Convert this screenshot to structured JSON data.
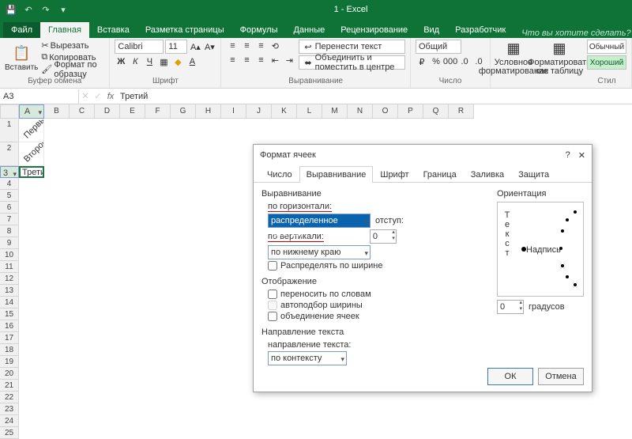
{
  "titlebar": {
    "title": "1 - Excel"
  },
  "menu": {
    "file": "Файл",
    "home": "Главная",
    "insert": "Вставка",
    "layout": "Разметка страницы",
    "formulas": "Формулы",
    "data": "Данные",
    "review": "Рецензирование",
    "view": "Вид",
    "developer": "Разработчик",
    "tell": "Что вы хотите сделать?"
  },
  "ribbon": {
    "clipboard": {
      "paste": "Вставить",
      "cut": "Вырезать",
      "copy": "Копировать",
      "painter": "Формат по образцу",
      "label": "Буфер обмена"
    },
    "font": {
      "name": "Calibri",
      "size": "11",
      "label": "Шрифт"
    },
    "align": {
      "wrap": "Перенести текст",
      "merge": "Объединить и поместить в центре",
      "label": "Выравнивание"
    },
    "number": {
      "fmt": "Общий",
      "label": "Число"
    },
    "cond": {
      "l1": "Условное",
      "l2": "форматирование"
    },
    "tbl": {
      "l1": "Форматировать",
      "l2": "как таблицу"
    },
    "styles": {
      "normal": "Обычный",
      "good": "Хороший",
      "label": "Стил"
    }
  },
  "formula": {
    "ref": "A3",
    "value": "Третий",
    "a1": "Первый",
    "a2": "Второй",
    "a3": "Третий"
  },
  "cols": [
    "A",
    "B",
    "C",
    "D",
    "E",
    "F",
    "G",
    "H",
    "I",
    "J",
    "K",
    "L",
    "M",
    "N",
    "O",
    "P",
    "Q",
    "R"
  ],
  "dialog": {
    "title": "Формат ячеек",
    "help": "?",
    "close": "✕",
    "tabs": {
      "number": "Число",
      "align": "Выравнивание",
      "font": "Шрифт",
      "border": "Граница",
      "fill": "Заливка",
      "protect": "Защита"
    },
    "align": {
      "group": "Выравнивание",
      "horiz_label": "по горизонтали:",
      "horiz_value": "распределенное (отступ)",
      "indent_label": "отступ:",
      "indent_value": "0",
      "vert_label": "по вертикали:",
      "vert_value": "по нижнему краю",
      "distribute": "Распределять по ширине",
      "display": "Отображение",
      "wrap": "переносить по словам",
      "autofit": "автоподбор ширины",
      "merge": "объединение ячеек",
      "textdir": "Направление текста",
      "textdir_label": "направление текста:",
      "textdir_value": "по контексту",
      "orient": "Ориентация",
      "orient_v": "Текст",
      "orient_h": "Надпись",
      "deg_value": "0",
      "deg_label": "градусов"
    },
    "ok": "ОК",
    "cancel": "Отмена"
  }
}
